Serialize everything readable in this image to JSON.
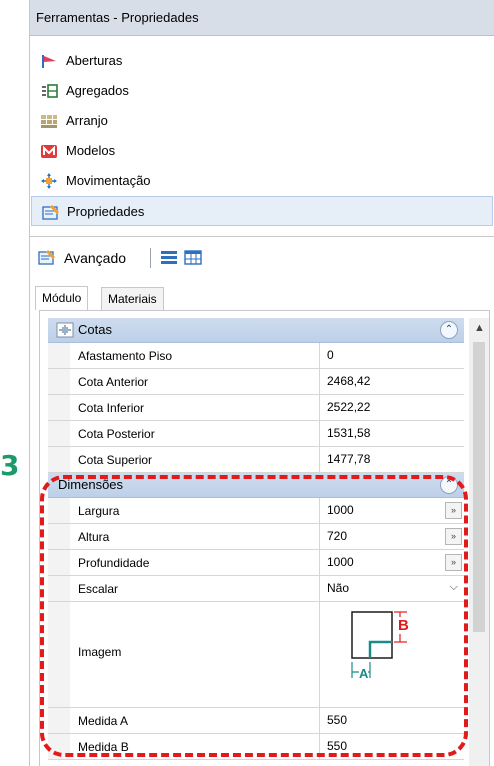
{
  "window": {
    "title": "Ferramentas - Propriedades",
    "pin_glyph": "⬝"
  },
  "menu": [
    {
      "label": "Aberturas",
      "icon": "openings-icon"
    },
    {
      "label": "Agregados",
      "icon": "aggregates-icon"
    },
    {
      "label": "Arranjo",
      "icon": "arrangement-icon"
    },
    {
      "label": "Modelos",
      "icon": "models-icon"
    },
    {
      "label": "Movimentação",
      "icon": "move-icon"
    },
    {
      "label": "Propriedades",
      "icon": "properties-icon",
      "selected": true
    }
  ],
  "toolbar": {
    "label": "Avançado"
  },
  "tabs": [
    "Módulo",
    "Materiais"
  ],
  "categories": {
    "cotas": {
      "label": "Cotas",
      "rows": [
        {
          "name": "Afastamento Piso",
          "value": "0"
        },
        {
          "name": "Cota Anterior",
          "value": "2468,42"
        },
        {
          "name": "Cota Inferior",
          "value": "2522,22"
        },
        {
          "name": "Cota Posterior",
          "value": "1531,58"
        },
        {
          "name": "Cota Superior",
          "value": "1477,78"
        }
      ]
    },
    "dimensoes": {
      "label": "Dimensões",
      "rows": [
        {
          "name": "Largura",
          "value": "1000",
          "button": "»"
        },
        {
          "name": "Altura",
          "value": "720",
          "button": "»"
        },
        {
          "name": "Profundidade",
          "value": "1000",
          "button": "»"
        },
        {
          "name": "Escalar",
          "value": "Não"
        },
        {
          "name": "Imagem",
          "value": ""
        },
        {
          "name": "Medida A",
          "value": "550"
        },
        {
          "name": "Medida B",
          "value": "550"
        }
      ],
      "image_labels": {
        "a": "A",
        "b": "B"
      }
    }
  },
  "annotation": {
    "label": "3",
    "accent": "#1b9a6a",
    "highlight": "#e11b1b"
  },
  "colors": {
    "titlebar": "#d8dee7",
    "category": "#c7d7ec",
    "selected": "#e6eef8"
  }
}
